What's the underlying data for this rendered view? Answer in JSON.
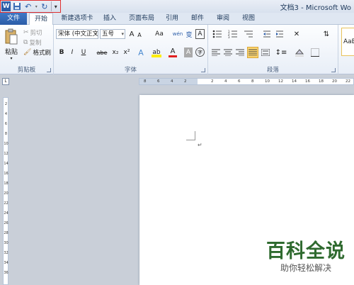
{
  "window": {
    "title": "文档3 - Microsoft Wo"
  },
  "tabs": [
    "文件",
    "开始",
    "新建选项卡",
    "插入",
    "页面布局",
    "引用",
    "邮件",
    "审阅",
    "视图"
  ],
  "clipboard": {
    "paste": "粘贴",
    "cut": "剪切",
    "copy": "复制",
    "format_painter": "格式刷",
    "label": "剪贴板"
  },
  "font": {
    "name": "宋体 (中文正文",
    "size": "五号",
    "label": "字体",
    "grow": "A",
    "shrink": "A",
    "case": "Aa",
    "wen": "wén",
    "change": "变",
    "border": "A",
    "bold": "B",
    "italic": "I",
    "underline": "U",
    "strike": "abe",
    "sub": "x₂",
    "sup": "x²",
    "effect": "A",
    "highlight": "ab",
    "color": "A",
    "shading": "A",
    "encircle": "字"
  },
  "paragraph": {
    "label": "段落"
  },
  "styles": {
    "preview": "AaBb"
  },
  "ruler": {
    "h_numbers": [
      "8",
      "6",
      "4",
      "2",
      "",
      "2",
      "4",
      "6",
      "8",
      "10",
      "12",
      "14",
      "16",
      "18",
      "20",
      "22"
    ],
    "v_numbers": [
      "2",
      "4",
      "6",
      "8",
      "10",
      "12",
      "14",
      "16",
      "18",
      "20",
      "22",
      "24",
      "26",
      "28",
      "30",
      "32",
      "34",
      "36"
    ]
  },
  "document": {
    "paragraph_mark": "↵"
  },
  "watermark": {
    "main": "百科全说",
    "sub": "助你轻松解决"
  },
  "colors": {
    "accent": "#2a5ca8",
    "highlight_qat": "#e03030"
  }
}
